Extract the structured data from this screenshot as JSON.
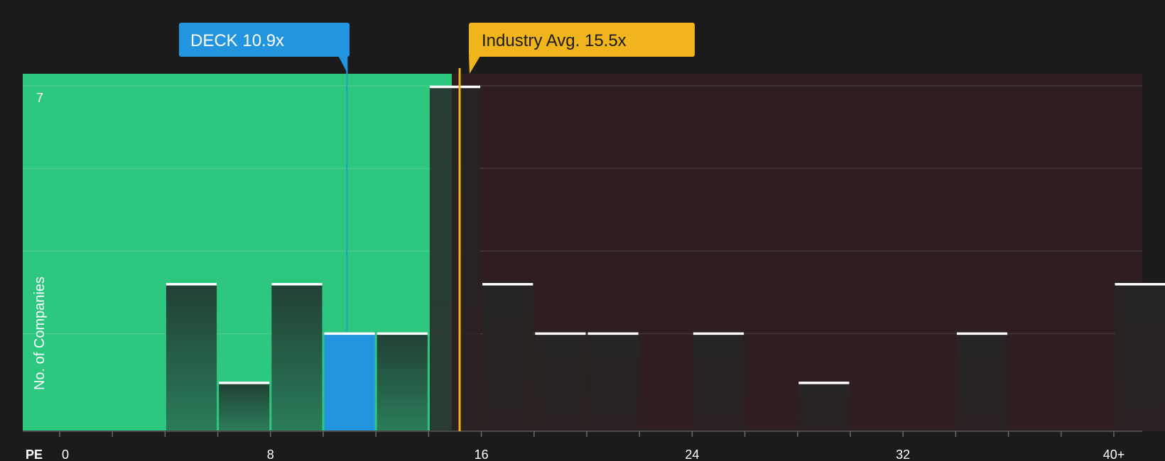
{
  "chart_data": {
    "type": "bar",
    "x_axis_label": "PE",
    "y_axis_label": "No. of Companies",
    "x_ticks": [
      "0",
      "8",
      "16",
      "24",
      "32",
      "40+"
    ],
    "y_tick_top": "7",
    "ylim": [
      0,
      7
    ],
    "grid": true,
    "bin_width": 2,
    "bins": [
      {
        "x": 0,
        "count": 0
      },
      {
        "x": 2,
        "count": 0
      },
      {
        "x": 4,
        "count": 3
      },
      {
        "x": 6,
        "count": 1
      },
      {
        "x": 8,
        "count": 3
      },
      {
        "x": 10,
        "count": 2
      },
      {
        "x": 12,
        "count": 2
      },
      {
        "x": 14,
        "count": 7
      },
      {
        "x": 16,
        "count": 3
      },
      {
        "x": 18,
        "count": 2
      },
      {
        "x": 20,
        "count": 2
      },
      {
        "x": 22,
        "count": 0
      },
      {
        "x": 24,
        "count": 2
      },
      {
        "x": 26,
        "count": 0
      },
      {
        "x": 28,
        "count": 1
      },
      {
        "x": 30,
        "count": 0
      },
      {
        "x": 32,
        "count": 0
      },
      {
        "x": 34,
        "count": 2
      },
      {
        "x": 36,
        "count": 0
      },
      {
        "x": 38,
        "count": 0
      },
      {
        "x": 40,
        "count": 3
      }
    ],
    "highlight_bin_x": 10,
    "company": {
      "label": "DECK 10.9x",
      "value": 10.9
    },
    "industry": {
      "label": "Industry Avg. 15.5x",
      "value": 15.5
    },
    "colors": {
      "background": "#1b1b1b",
      "undervalued_zone": "#2ec780",
      "overvalued_zone": "#2e1e1f",
      "company": "#2394e0",
      "industry": "#f0b41c",
      "bar_cap": "#ffffff"
    }
  }
}
